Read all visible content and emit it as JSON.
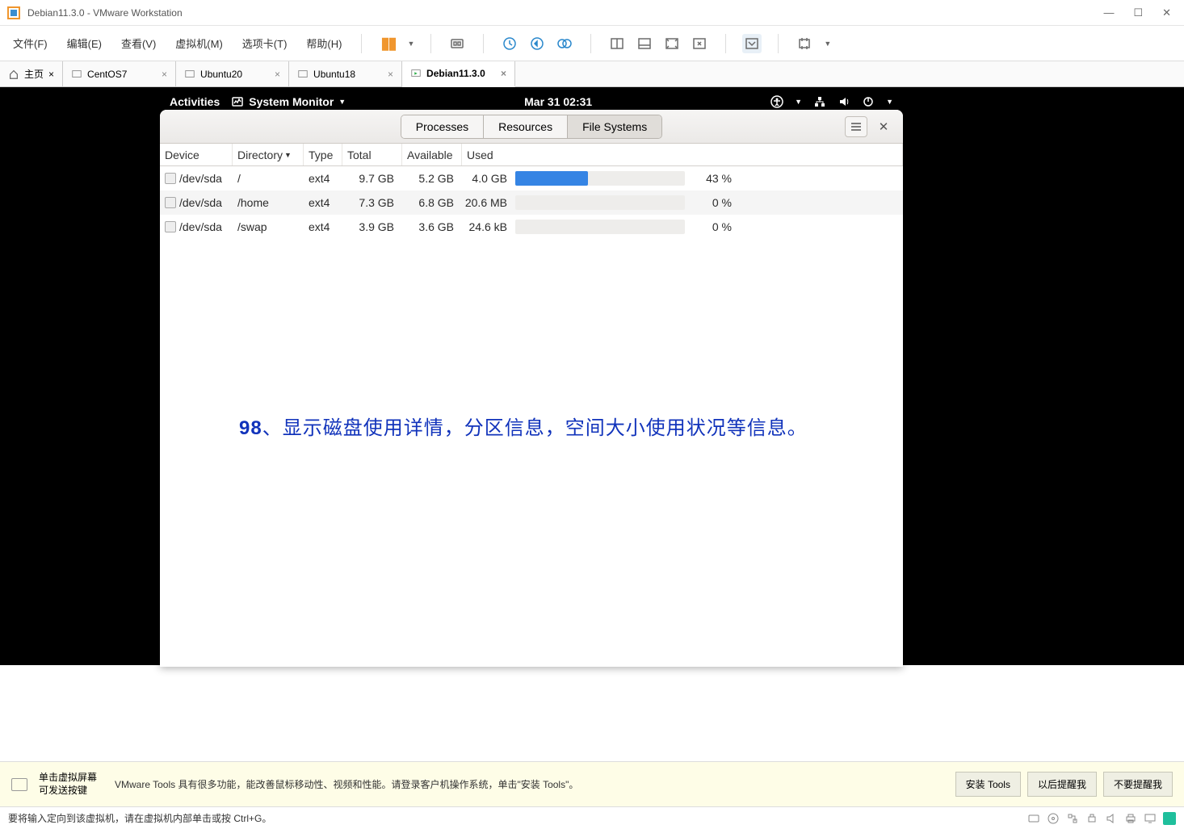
{
  "window": {
    "title": "Debian11.3.0 - VMware Workstation",
    "controls": {
      "min": "—",
      "max": "☐",
      "close": "✕"
    }
  },
  "menu": [
    "文件(F)",
    "编辑(E)",
    "查看(V)",
    "虚拟机(M)",
    "选项卡(T)",
    "帮助(H)"
  ],
  "tabs": {
    "home": "主页",
    "items": [
      {
        "label": "CentOS7",
        "active": false
      },
      {
        "label": "Ubuntu20",
        "active": false
      },
      {
        "label": "Ubuntu18",
        "active": false
      },
      {
        "label": "Debian11.3.0",
        "active": true
      }
    ]
  },
  "gnome": {
    "activities": "Activities",
    "appmenu": "System Monitor",
    "datetime": "Mar 31  02:31"
  },
  "sysmon": {
    "tabs": [
      "Processes",
      "Resources",
      "File Systems"
    ],
    "active_tab": 2,
    "columns": [
      "Device",
      "Directory",
      "Type",
      "Total",
      "Available",
      "Used"
    ],
    "rows": [
      {
        "device": "/dev/sda",
        "dir": "/",
        "type": "ext4",
        "total": "9.7 GB",
        "avail": "5.2 GB",
        "used": "4.0 GB",
        "pct": "43 %",
        "bar": 43
      },
      {
        "device": "/dev/sda",
        "dir": "/home",
        "type": "ext4",
        "total": "7.3 GB",
        "avail": "6.8 GB",
        "used": "20.6 MB",
        "pct": "0 %",
        "bar": 0
      },
      {
        "device": "/dev/sda",
        "dir": "/swap",
        "type": "ext4",
        "total": "3.9 GB",
        "avail": "3.6 GB",
        "used": "24.6 kB",
        "pct": "0 %",
        "bar": 0
      }
    ]
  },
  "annotation": {
    "num": "98",
    "text": "、显示磁盘使用详情，分区信息，空间大小使用状况等信息。"
  },
  "infobar": {
    "msg1": "单击虚拟屏幕可发送按键",
    "msg2": "VMware Tools 具有很多功能，能改善鼠标移动性、视频和性能。请登录客户机操作系统，单击\"安装 Tools\"。",
    "btn1": "安装 Tools",
    "btn2": "以后提醒我",
    "btn3": "不要提醒我"
  },
  "status": "要将输入定向到该虚拟机，请在虚拟机内部单击或按 Ctrl+G。"
}
